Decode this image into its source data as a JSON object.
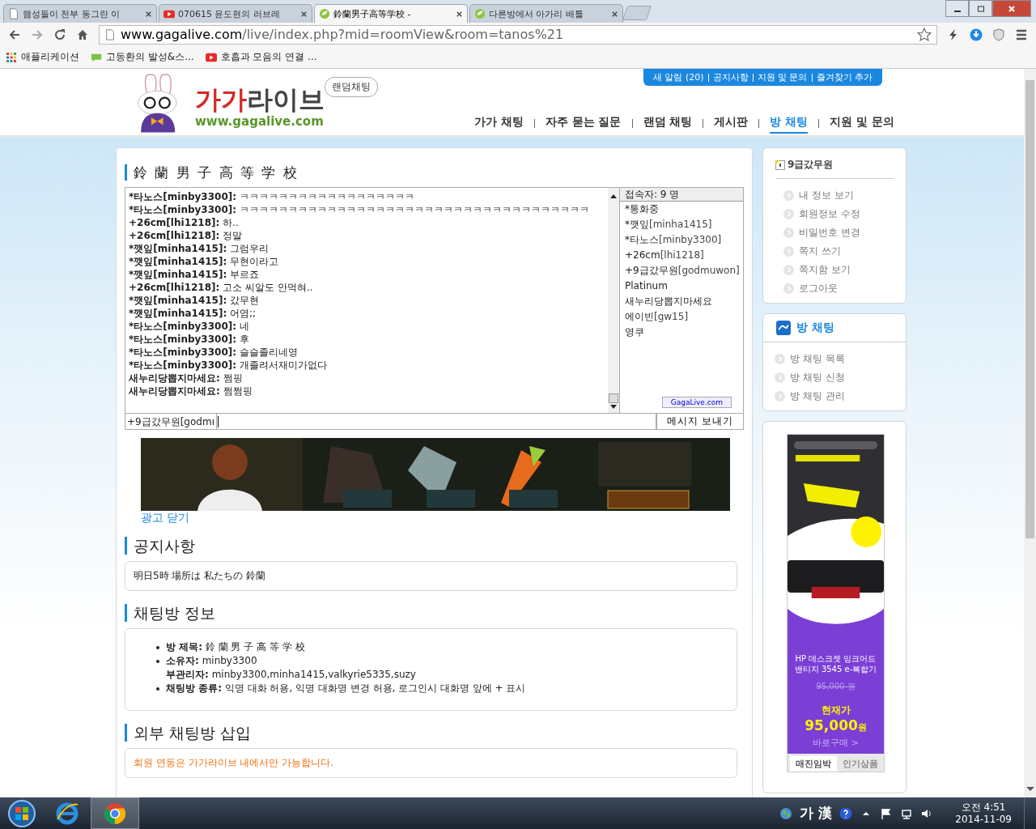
{
  "browser": {
    "tabs": [
      {
        "title": "햄성들이 전부 동그란 이",
        "kind": "page",
        "selected": false
      },
      {
        "title": "070615 윤도현의 러브레",
        "kind": "video",
        "selected": false
      },
      {
        "title": "鈴蘭男子高等学校 -",
        "kind": "site",
        "selected": true
      },
      {
        "title": "다른방에서 아가리 배틀",
        "kind": "site",
        "selected": false
      }
    ],
    "url_host": "www.gagalive.com",
    "url_path": "/live/index.php?mid=roomView&room=tanos%21",
    "bookmarks": [
      {
        "label": "애플리케이션",
        "kind": "apps"
      },
      {
        "label": "고동환의 발성&스...",
        "kind": "blog"
      },
      {
        "label": "호흡과 모음의 연결 ...",
        "kind": "video"
      }
    ]
  },
  "header": {
    "logo_red": "가가",
    "logo_dark": "라이브",
    "logo_url": "www.gagalive.com",
    "badge": "랜덤채팅",
    "top_links": [
      "새 알림 (20)",
      "공지사항",
      "지원 및 문의",
      "즐겨찾기 추가"
    ],
    "nav": [
      {
        "label": "가가 채팅",
        "selected": false
      },
      {
        "label": "자주 묻는 질문",
        "selected": false
      },
      {
        "label": "랜덤 채팅",
        "selected": false
      },
      {
        "label": "게시판",
        "selected": false
      },
      {
        "label": "방 채팅",
        "selected": true
      },
      {
        "label": "지원 및 문의",
        "selected": false
      }
    ]
  },
  "room": {
    "title": "鈴 蘭 男 子 高 等 学 校",
    "messages": [
      {
        "user": "*타노스[minby3300]:",
        "text": "ㅋㅋㅋㅋㅋㅋㅋㅋㅋㅋㅋㅋㅋㅋㅋㅋㅋㅋ"
      },
      {
        "user": "*타노스[minby3300]:",
        "text": "ㅋㅋㅋㅋㅋㅋㅋㅋㅋㅋㅋㅋㅋㅋㅋㅋㅋㅋㅋㅋㅋㅋㅋㅋㅋㅋㅋㅋㅋㅋㅋㅋㅋㅋㅋㅋ"
      },
      {
        "user": "+26cm[lhi1218]:",
        "text": "하.."
      },
      {
        "user": "+26cm[lhi1218]:",
        "text": "정말"
      },
      {
        "user": "*깻잎[minha1415]:",
        "text": "그럼우리"
      },
      {
        "user": "*깻잎[minha1415]:",
        "text": "무현이라고"
      },
      {
        "user": "*깻잎[minha1415]:",
        "text": "부르죠"
      },
      {
        "user": "+26cm[lhi1218]:",
        "text": "고소 씨알도 안먹혀.."
      },
      {
        "user": "*깻잎[minha1415]:",
        "text": "갔무현"
      },
      {
        "user": "*깻잎[minha1415]:",
        "text": "어염;;"
      },
      {
        "user": "*타노스[minby3300]:",
        "text": "네"
      },
      {
        "user": "*타노스[minby3300]:",
        "text": "후"
      },
      {
        "user": "*타노스[minby3300]:",
        "text": "슬슬졸리네영"
      },
      {
        "user": "*타노스[minby3300]:",
        "text": "개졸려서재미가없다"
      },
      {
        "user": "새누리당뽑지마세요:",
        "text": "쩜핑"
      },
      {
        "user": "새누리당뽑지마세요:",
        "text": "쩜쩜핑"
      }
    ],
    "users_header": "접속자: 9 명",
    "users": [
      {
        "name": "*통화중"
      },
      {
        "name": "*깻잎",
        "id": "[minha1415]"
      },
      {
        "name": "*타노스",
        "id": "[minby3300]"
      },
      {
        "name": "+26cm",
        "id": "[lhi1218]"
      },
      {
        "name": "+9급갔무원",
        "id": "[godmuwon]"
      },
      {
        "name": "Platinum"
      },
      {
        "name": "새누리당뽑지마세요"
      },
      {
        "name": "에이빈",
        "id": "[gw15]"
      },
      {
        "name": "영쿠"
      }
    ],
    "brand": "GagaLive.com",
    "nickname": "+9급갔무원[godmı",
    "send": "메시지 보내기"
  },
  "ad_close": "광고 닫기",
  "notice": {
    "title": "공지사항",
    "text": "明日5時 場所は 私たちの 鈴蘭"
  },
  "info": {
    "title": "채팅방 정보",
    "items": [
      {
        "lines": [
          {
            "label": "방 제목:",
            "value": "鈴 蘭 男 子 高 等 学 校"
          }
        ]
      },
      {
        "lines": [
          {
            "label": "소유자:",
            "value": "minby3300"
          },
          {
            "label": "부관리자:",
            "value": "minby3300,minha1415,valkyrie5335,suzy"
          }
        ]
      },
      {
        "lines": [
          {
            "label": "채팅방 종류:",
            "value": "익명 대화 허용, 익명 대화명 변경 허용, 로그인시 대화명 앞에 + 표시"
          }
        ]
      }
    ]
  },
  "embed": {
    "title": "외부 채팅방 삽입",
    "text": "회원 연동은 가가라이브 내에서만 가능합니다."
  },
  "sidebar": {
    "user": "9급갔무원",
    "user_links": [
      "내 정보 보기",
      "회원정보 수정",
      "비밀번호 변경",
      "쪽지 쓰기",
      "쪽지함 보기",
      "로그아웃"
    ],
    "room_title": "방 채팅",
    "room_links": [
      "방 채팅 목록",
      "방 채팅 신청",
      "방 채팅 관리"
    ]
  },
  "ad": {
    "product": [
      "HP 데스크젯 잉크어드",
      "밴티지 3545 e-복합기"
    ],
    "old_price": "95,000 원",
    "now_label": "현재가",
    "price": "95,000",
    "price_unit": "원",
    "buy": "바로구매 >",
    "tabs": [
      {
        "label": "매진임박",
        "selected": true
      },
      {
        "label": "인기상품",
        "selected": false
      }
    ]
  },
  "taskbar": {
    "ime": "가 漢",
    "time": "오전 4:51",
    "date": "2014-11-09"
  }
}
